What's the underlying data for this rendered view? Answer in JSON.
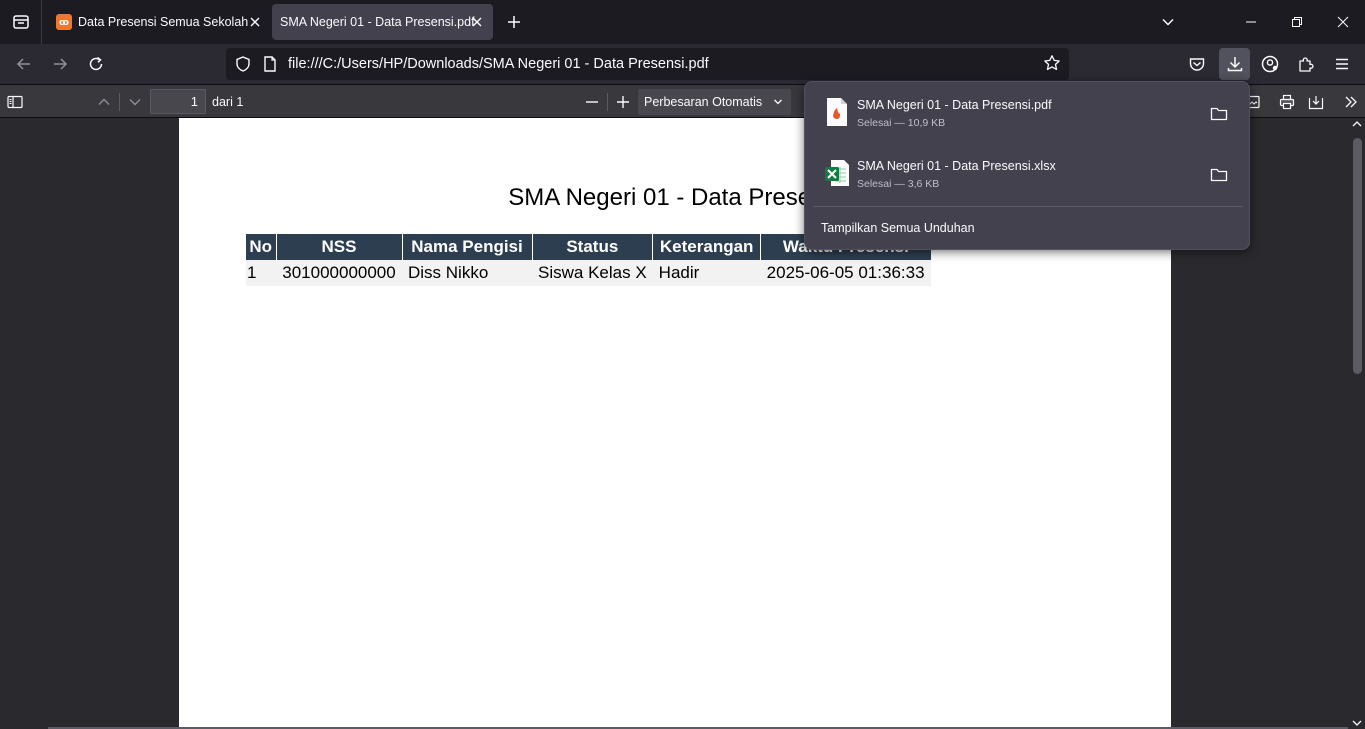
{
  "tabs": [
    {
      "title": "Data Presensi Semua Sekolah",
      "favicon": "xampp-icon",
      "active": false
    },
    {
      "title": "SMA Negeri 01 - Data Presensi.pdf",
      "active": true
    }
  ],
  "address_bar": {
    "url": "file:///C:/Users/HP/Downloads/SMA Negeri 01 - Data Presensi.pdf"
  },
  "pdf_toolbar": {
    "page_number": "1",
    "page_of": "dari 1",
    "zoom": "Perbesaran Otomatis"
  },
  "document": {
    "title": "SMA Negeri 01 - Data Presensi",
    "columns": [
      "No",
      "NSS",
      "Nama Pengisi",
      "Status",
      "Keterangan",
      "Waktu Presensi"
    ],
    "rows": [
      [
        "1",
        "301000000000",
        "Diss Nikko",
        "Siswa Kelas X",
        "Hadir",
        "2025-06-05 01:36:33"
      ]
    ]
  },
  "downloads": {
    "items": [
      {
        "name": "SMA Negeri 01 - Data Presensi.pdf",
        "status": "Selesai — 10,9 KB",
        "icon": "pdf-file-icon"
      },
      {
        "name": "SMA Negeri 01 - Data Presensi.xlsx",
        "status": "Selesai — 3,6 KB",
        "icon": "excel-file-icon"
      }
    ],
    "show_all": "Tampilkan Semua Unduhan"
  },
  "colors": {
    "table_header": "#2c3e50",
    "tab_active": "#42414d",
    "chrome_dark": "#1c1b22"
  }
}
